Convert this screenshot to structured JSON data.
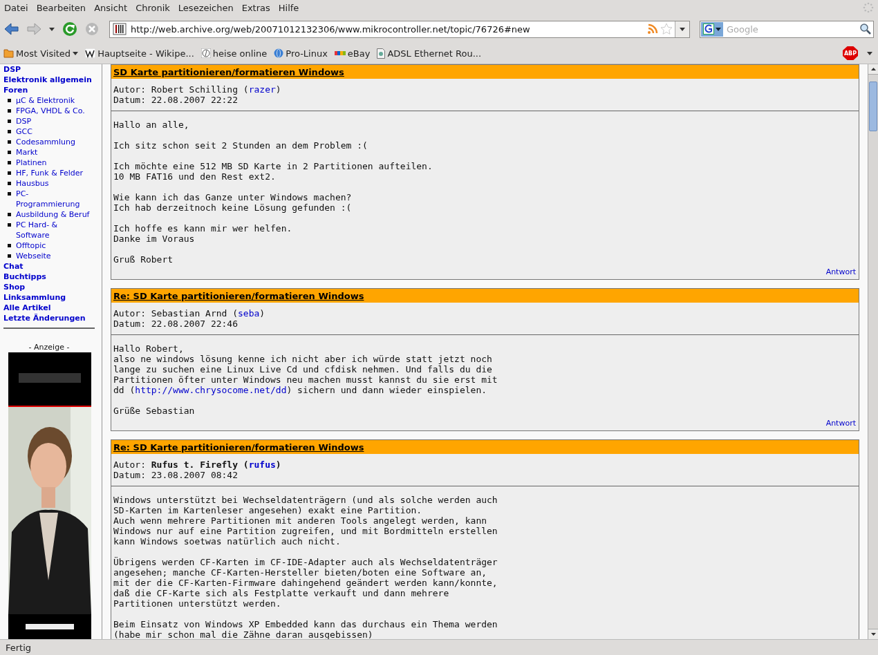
{
  "menu": [
    "Datei",
    "Bearbeiten",
    "Ansicht",
    "Chronik",
    "Lesezeichen",
    "Extras",
    "Hilfe"
  ],
  "navigation": {
    "address": "http://web.archive.org/web/20071012132306/www.mikrocontroller.net/topic/76726#new",
    "search_placeholder": "Google",
    "back_disabled": false,
    "forward_disabled": true
  },
  "bookmarks": [
    {
      "label": "Most Visited",
      "kind": "folder"
    },
    {
      "label": "Hauptseite - Wikipe...",
      "kind": "wiki"
    },
    {
      "label": "heise online",
      "kind": "heise"
    },
    {
      "label": "Pro-Linux",
      "kind": "globe"
    },
    {
      "label": "eBay",
      "kind": "ebay"
    },
    {
      "label": "ADSL Ethernet Rou...",
      "kind": "page"
    }
  ],
  "adblock_label": "ABP",
  "sidebar": {
    "items": [
      {
        "label": "DSP"
      },
      {
        "label": "Elektronik allgemein"
      },
      {
        "label": "Foren",
        "children": [
          {
            "label": "µC & Elektronik"
          },
          {
            "label": "FPGA, VHDL & Co."
          },
          {
            "label": "DSP"
          },
          {
            "label": "GCC"
          },
          {
            "label": "Codesammlung"
          },
          {
            "label": "Markt"
          },
          {
            "label": "Platinen"
          },
          {
            "label": "HF, Funk & Felder"
          },
          {
            "label": "Hausbus"
          },
          {
            "label": "PC-Programmierung"
          },
          {
            "label": "Ausbildung & Beruf"
          },
          {
            "label": "PC Hard- & Software"
          },
          {
            "label": "Offtopic"
          },
          {
            "label": "Webseite"
          }
        ]
      },
      {
        "label": "Chat"
      },
      {
        "label": "Buchtipps"
      },
      {
        "label": "Shop"
      },
      {
        "label": "Linksammlung"
      },
      {
        "label": "Alle Artikel"
      },
      {
        "label": "Letzte Änderungen"
      }
    ],
    "ad_label": "- Anzeige -"
  },
  "posts": [
    {
      "title": "SD Karte partitionieren/formatieren Windows",
      "author_label": "Autor:",
      "author": "Robert Schilling",
      "paren_open": "(",
      "username": "razer",
      "paren_close": ")",
      "author_bold": false,
      "date_label": "Datum:",
      "date": "22.08.2007 22:22",
      "reply": "Antwort",
      "body": [
        [
          "Hallo an alle,"
        ],
        [
          "Ich sitz schon seit 2 Stunden an dem Problem :("
        ],
        [
          "Ich möchte eine 512 MB SD Karte in 2 Partitionen aufteilen.",
          "10 MB FAT16 und den Rest ext2."
        ],
        [
          "Wie kann ich das Ganze unter Windows machen?",
          "Ich hab derzeitnoch keine Lösung gefunden :("
        ],
        [
          "Ich hoffe es kann mir wer helfen.",
          "Danke im Voraus"
        ],
        [
          "Gruß Robert"
        ]
      ]
    },
    {
      "title": "Re: SD Karte partitionieren/formatieren Windows",
      "author_label": "Autor:",
      "author": "Sebastian Arnd",
      "paren_open": "(",
      "username": "seba",
      "paren_close": ")",
      "author_bold": false,
      "date_label": "Datum:",
      "date": "22.08.2007 22:46",
      "reply": "Antwort",
      "body": [
        [
          "Hallo Robert,",
          "also ne windows lösung kenne ich nicht aber ich würde statt jetzt noch",
          "lange zu suchen eine Linux Live Cd und cfdisk nehmen. Und falls du die",
          "Partitionen öfter unter Windows neu machen musst kannst du sie erst mit",
          [
            {
              "text": "dd ("
            },
            {
              "text": "http://www.chrysocome.net/dd",
              "link": true
            },
            {
              "text": ") sichern und dann wieder einspielen."
            }
          ]
        ],
        [
          "Grüße Sebastian"
        ]
      ]
    },
    {
      "title": "Re: SD Karte partitionieren/formatieren Windows",
      "author_label": "Autor:",
      "author": "Rufus t. Firefly",
      "paren_open": "(",
      "username": "rufus",
      "paren_close": ")",
      "author_bold": true,
      "date_label": "Datum:",
      "date": "23.08.2007 08:42",
      "body": [
        [
          "Windows unterstützt bei Wechseldatenträgern (und als solche werden auch",
          "SD-Karten im Kartenleser angesehen) exakt eine Partition.",
          "Auch wenn mehrere Partitionen mit anderen Tools angelegt werden, kann",
          "Windows nur auf eine Partition zugreifen, und mit Bordmitteln erstellen",
          "kann Windows soetwas natürlich auch nicht."
        ],
        [
          "Übrigens werden CF-Karten im CF-IDE-Adapter auch als Wechseldatenträger",
          "angesehen; manche CF-Karten-Hersteller bieten/boten eine Software an,",
          "mit der die CF-Karten-Firmware dahingehend geändert werden kann/konnte,",
          "daß die CF-Karte sich als Festplatte verkauft und dann mehrere",
          "Partitionen unterstützt werden."
        ],
        [
          "Beim Einsatz von Windows XP Embedded kann das durchaus ein Thema werden",
          "(habe mir schon mal die Zähne daran ausgebissen)"
        ]
      ]
    }
  ],
  "status": "Fertig"
}
